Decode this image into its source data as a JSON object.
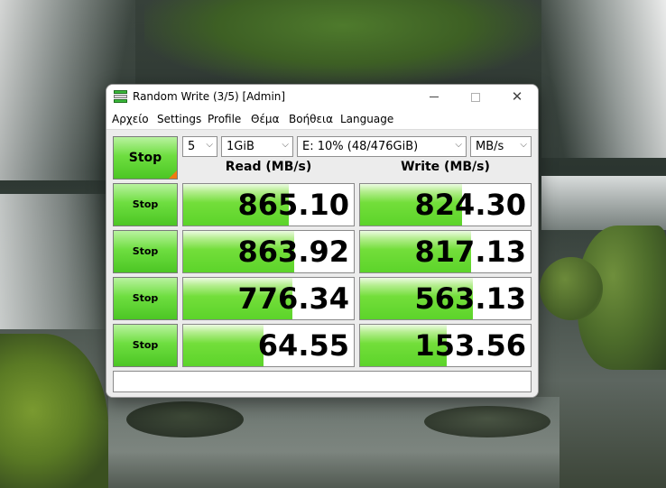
{
  "window": {
    "title": "Random Write (3/5) [Admin]",
    "icon": "crystaldiskmark-app-icon",
    "controls": {
      "minimize": "minimize-icon",
      "maximize": "maximize-icon",
      "close": "close-icon",
      "close_glyph": "✕"
    }
  },
  "menu": [
    "Αρχείο",
    "Settings",
    "Profile",
    "Θέμα",
    "Βοήθεια",
    "Language"
  ],
  "toolbar": {
    "all_button": "Stop",
    "count": "5",
    "size": "1GiB",
    "drive": "E: 10% (48/476GiB)",
    "unit": "MB/s",
    "chevron": "⌵"
  },
  "headers": {
    "read": "Read (MB/s)",
    "write": "Write (MB/s)"
  },
  "rows": [
    {
      "button": "Stop",
      "read": "865.10",
      "read_fill": 0.62,
      "write": "824.30",
      "write_fill": 0.6
    },
    {
      "button": "Stop",
      "read": "863.92",
      "read_fill": 0.65,
      "write": "817.13",
      "write_fill": 0.65
    },
    {
      "button": "Stop",
      "read": "776.34",
      "read_fill": 0.64,
      "write": "563.13",
      "write_fill": 0.66
    },
    {
      "button": "Stop",
      "read": "64.55",
      "read_fill": 0.47,
      "write": "153.56",
      "write_fill": 0.51
    }
  ],
  "comment": "",
  "colors": {
    "accent_green": "#5cd42a",
    "corner_orange": "#f07a10"
  }
}
